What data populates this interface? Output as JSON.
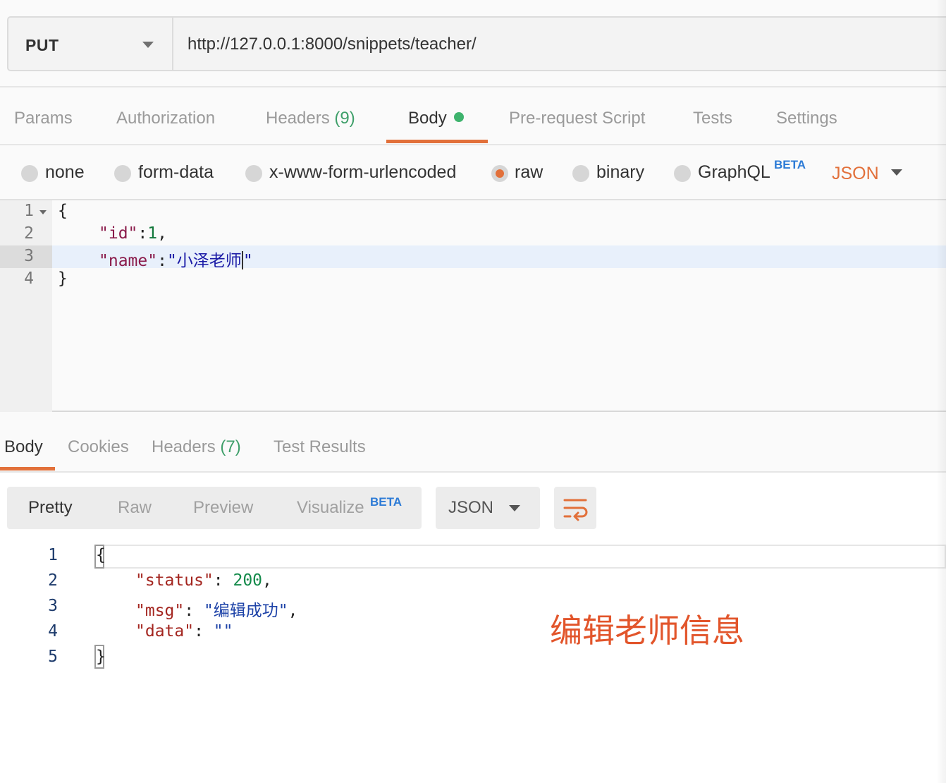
{
  "request": {
    "method": "PUT",
    "url": "http://127.0.0.1:8000/snippets/teacher/"
  },
  "request_tabs": {
    "params": "Params",
    "authorization": "Authorization",
    "headers": "Headers",
    "headers_count": "(9)",
    "body": "Body",
    "pre_request": "Pre-request Script",
    "tests": "Tests",
    "settings": "Settings"
  },
  "body_types": {
    "none": "none",
    "form_data": "form-data",
    "urlencoded": "x-www-form-urlencoded",
    "raw": "raw",
    "binary": "binary",
    "graphql": "GraphQL",
    "graphql_badge": "BETA",
    "selected": "raw",
    "format": "JSON"
  },
  "request_editor": {
    "line_numbers": [
      "1",
      "2",
      "3",
      "4"
    ],
    "open_brace": "{",
    "close_brace": "}",
    "key_id": "\"id\"",
    "val_id": "1",
    "key_name": "\"name\"",
    "val_name_open": "\"小泽老师",
    "val_name_close": "\""
  },
  "response_tabs": {
    "body": "Body",
    "cookies": "Cookies",
    "headers": "Headers",
    "headers_count": "(7)",
    "test_results": "Test Results"
  },
  "response_toolbar": {
    "pretty": "Pretty",
    "raw": "Raw",
    "preview": "Preview",
    "visualize": "Visualize",
    "visualize_badge": "BETA",
    "format": "JSON"
  },
  "response_body": {
    "line_numbers": [
      "1",
      "2",
      "3",
      "4",
      "5"
    ],
    "open_brace": "{",
    "close_brace": "}",
    "key_status": "\"status\"",
    "val_status": "200",
    "key_msg": "\"msg\"",
    "val_msg": "\"编辑成功\"",
    "key_data": "\"data\"",
    "val_data": "\"\""
  },
  "annotation": "编辑老师信息",
  "colors": {
    "accent": "#e2703a",
    "status_dot": "#3eb36d",
    "beta": "#2d7bd6",
    "annotation": "#e2552b"
  }
}
